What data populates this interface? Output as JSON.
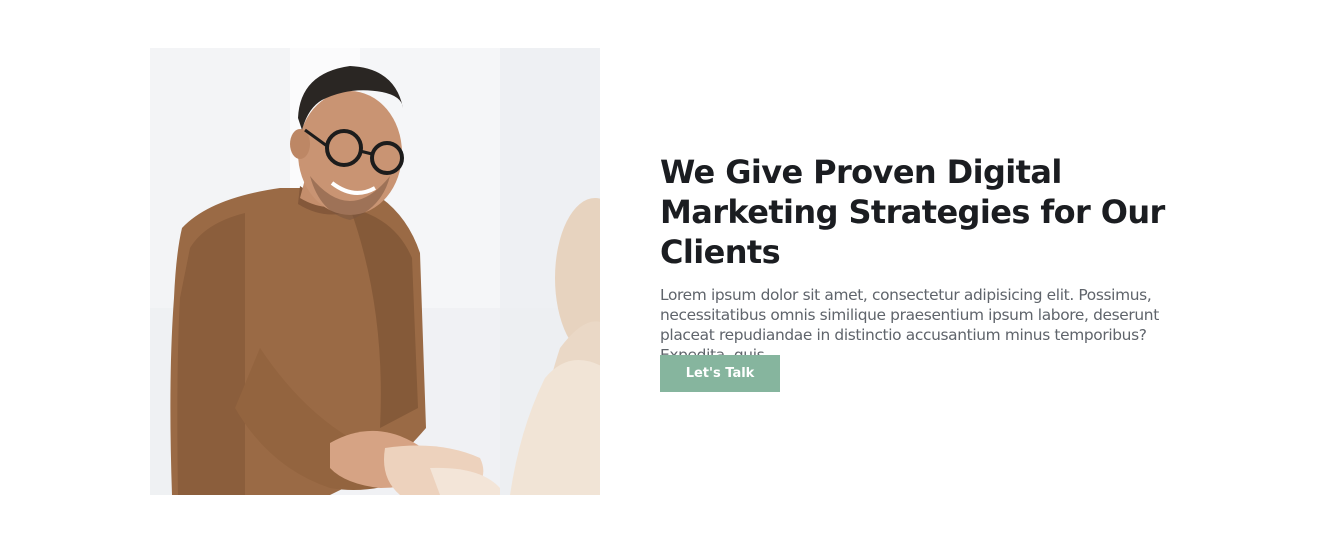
{
  "hero": {
    "image_alt": "Smiling man in glasses shaking hands",
    "title": "We Give Proven Digital Marketing Strategies for Our Clients",
    "description": "Lorem ipsum dolor sit amet, consectetur adipisicing elit. Possimus, necessitatibus omnis similique praesentium ipsum labore, deserunt placeat repudiandae in distinctio accusantium minus temporibus? Expedita, quis.",
    "cta_label": "Let's Talk"
  },
  "colors": {
    "accent": "#86b59e",
    "heading": "#1b1d21",
    "body_text": "#5f646b",
    "background": "#ffffff"
  }
}
